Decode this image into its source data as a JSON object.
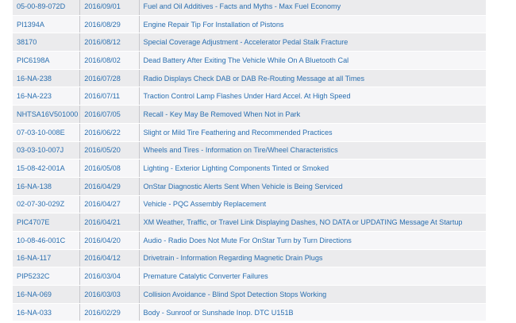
{
  "bulletins": [
    {
      "number": "05-00-89-072D",
      "date": "2016/09/01",
      "title": "Fuel and Oil Additives - Facts and Myths - Max Fuel Economy"
    },
    {
      "number": "PI1394A",
      "date": "2016/08/29",
      "title": "Engine Repair Tip For Installation of Pistons"
    },
    {
      "number": "38170",
      "date": "2016/08/12",
      "title": "Special Coverage Adjustment - Accelerator Pedal Stalk Fracture"
    },
    {
      "number": "PIC6198A",
      "date": "2016/08/02",
      "title": "Dead Battery After Exiting The Vehicle While On A Bluetooth Cal"
    },
    {
      "number": "16-NA-238",
      "date": "2016/07/28",
      "title": "Radio Displays Check DAB or DAB Re-Routing Message at all Times"
    },
    {
      "number": "16-NA-223",
      "date": "2016/07/11",
      "title": "Traction Control Lamp Flashes Under Hard Accel. At High Speed"
    },
    {
      "number": "NHTSA16V501000",
      "date": "2016/07/05",
      "title": "Recall - Key May Be Removed When Not in Park"
    },
    {
      "number": "07-03-10-008E",
      "date": "2016/06/22",
      "title": "Slight or Mild Tire Feathering and Recommended Practices"
    },
    {
      "number": "03-03-10-007J",
      "date": "2016/05/20",
      "title": "Wheels and Tires - Information on Tire/Wheel Characteristics"
    },
    {
      "number": "15-08-42-001A",
      "date": "2016/05/08",
      "title": "Lighting - Exterior Lighting Components Tinted or Smoked"
    },
    {
      "number": "16-NA-138",
      "date": "2016/04/29",
      "title": "OnStar Diagnostic Alerts Sent When Vehicle is Being Serviced"
    },
    {
      "number": "02-07-30-029Z",
      "date": "2016/04/27",
      "title": "Vehicle - PQC Assembly Replacement"
    },
    {
      "number": "PIC4707E",
      "date": "2016/04/21",
      "title": "XM Weather, Traffic, or Travel Link Displaying Dashes, NO DATA or UPDATING Message At Startup"
    },
    {
      "number": "10-08-46-001C",
      "date": "2016/04/20",
      "title": "Audio - Radio Does Not Mute For OnStar Turn by Turn Directions"
    },
    {
      "number": "16-NA-117",
      "date": "2016/04/12",
      "title": "Drivetrain - Information Regarding Magnetic Drain Plugs"
    },
    {
      "number": "PIP5232C",
      "date": "2016/03/04",
      "title": "Premature Catalytic Converter Failures"
    },
    {
      "number": "16-NA-069",
      "date": "2016/03/03",
      "title": "Collision Avoidance - Blind Spot Detection Stops Working"
    },
    {
      "number": "16-NA-033",
      "date": "2016/02/29",
      "title": "Body - Sunroof or Sunshade Inop. DTC U151B"
    }
  ]
}
